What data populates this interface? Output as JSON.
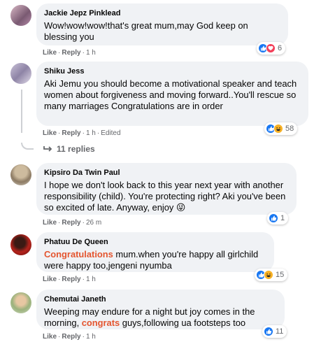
{
  "comments": [
    {
      "author": "Jackie Jepz Pinklead",
      "text": "Wow!wow!wow!that's great mum,may God keep on blessing you",
      "like": "Like",
      "reply": "Reply",
      "time": "1 h",
      "edited": "",
      "reaction_count": "6",
      "reactions": [
        "like-icon",
        "love-icon"
      ]
    },
    {
      "author": "Shiku Jess",
      "text": "Aki Jemu you should become a motivational speaker and teach women about forgiveness and moving forward..You'll rescue so many marriages Congratulations are in order",
      "like": "Like",
      "reply": "Reply",
      "time": "1 h",
      "edited": "Edited",
      "reaction_count": "58",
      "reactions": [
        "like-icon",
        "haha-icon"
      ],
      "replies_label": "11 replies"
    },
    {
      "author": "Kipsiro Da Twin Paul",
      "text": "I hope we don't look back to this year next year with another responsibility (child). You're protecting right? Aki you've been so excited of late. Anyway, enjoy 😜",
      "like": "Like",
      "reply": "Reply",
      "time": "26 m",
      "edited": "",
      "reaction_count": "1",
      "reactions": [
        "like-icon"
      ]
    },
    {
      "author": "Phatuu De Queen",
      "text_parts": [
        "Congratulations",
        " mum.when you're happy all girlchild were happy too,jengeni nyumba"
      ],
      "like": "Like",
      "reply": "Reply",
      "time": "1 h",
      "edited": "",
      "reaction_count": "15",
      "reactions": [
        "like-icon",
        "haha-icon"
      ]
    },
    {
      "author": "Chemutai Janeth",
      "text_parts": [
        "Weeping may endure for a night but joy comes in the morning, ",
        "congrats",
        " guys,following ua footsteps too"
      ],
      "like": "Like",
      "reply": "Reply",
      "time": "1 h",
      "edited": "",
      "reaction_count": "11",
      "reactions": [
        "like-icon"
      ]
    }
  ],
  "colors": {
    "bubble": "#f0f2f5",
    "secondary_text": "#65676b",
    "highlight": "#e4552f",
    "like_blue": "#1877f2",
    "love_red": "#f33e58",
    "haha_yellow": "#f7b125"
  }
}
